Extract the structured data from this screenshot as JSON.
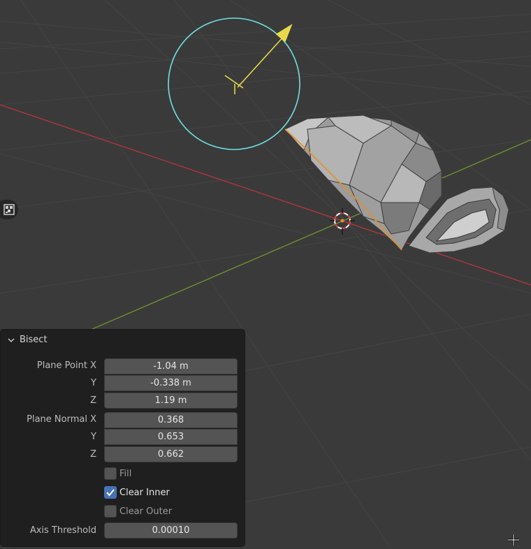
{
  "operator_panel": {
    "title": "Bisect",
    "plane_point": {
      "label": "Plane Point X",
      "y_label": "Y",
      "z_label": "Z",
      "x": "-1.04 m",
      "y": "-0.338 m",
      "z": "1.19 m"
    },
    "plane_normal": {
      "label": "Plane Normal X",
      "y_label": "Y",
      "z_label": "Z",
      "x": "0.368",
      "y": "0.653",
      "z": "0.662"
    },
    "fill": {
      "label": "Fill",
      "checked": false
    },
    "clear_inner": {
      "label": "Clear Inner",
      "checked": true
    },
    "clear_outer": {
      "label": "Clear Outer",
      "checked": false
    },
    "axis_threshold": {
      "label": "Axis Threshold",
      "value": "0.00010"
    }
  },
  "viewport": {
    "background": "#3a3a3a",
    "x_axis_color": "#b0363d",
    "y_axis_color": "#6f9030",
    "gizmo_circle_color": "#6fe0e0",
    "gizmo_arrow_color": "#e8d84a",
    "cut_line_color": "#e0902a",
    "mesh_color": "#9a9a9a"
  },
  "icons": {
    "side_toggle": "object-mode-icon",
    "cursor": "crosshair-cursor-icon"
  }
}
